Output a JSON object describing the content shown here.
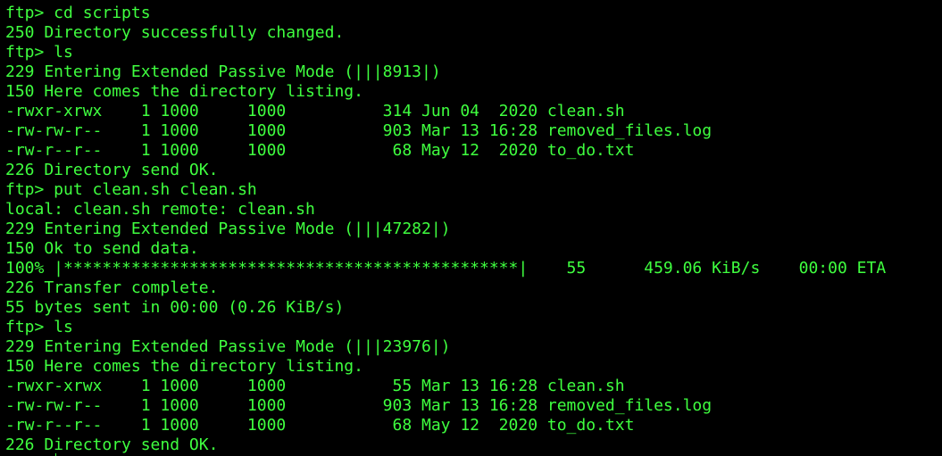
{
  "terminal": {
    "lines": [
      "ftp> cd scripts",
      "250 Directory successfully changed.",
      "ftp> ls",
      "229 Entering Extended Passive Mode (|||8913|)",
      "150 Here comes the directory listing.",
      "-rwxr-xrwx    1 1000     1000          314 Jun 04  2020 clean.sh",
      "-rw-rw-r--    1 1000     1000          903 Mar 13 16:28 removed_files.log",
      "-rw-r--r--    1 1000     1000           68 May 12  2020 to_do.txt",
      "226 Directory send OK.",
      "ftp> put clean.sh clean.sh",
      "local: clean.sh remote: clean.sh",
      "229 Entering Extended Passive Mode (|||47282|)",
      "150 Ok to send data.",
      "100% |***********************************************|    55      459.06 KiB/s    00:00 ETA",
      "226 Transfer complete.",
      "55 bytes sent in 00:00 (0.26 KiB/s)",
      "ftp> ls",
      "229 Entering Extended Passive Mode (|||23976|)",
      "150 Here comes the directory listing.",
      "-rwxr-xrwx    1 1000     1000           55 Mar 13 16:28 clean.sh",
      "-rw-rw-r--    1 1000     1000          903 Mar 13 16:28 removed_files.log",
      "-rw-r--r--    1 1000     1000           68 May 12  2020 to_do.txt",
      "226 Directory send OK."
    ],
    "text_color": "#3fff3f",
    "background_color": "#000000"
  }
}
